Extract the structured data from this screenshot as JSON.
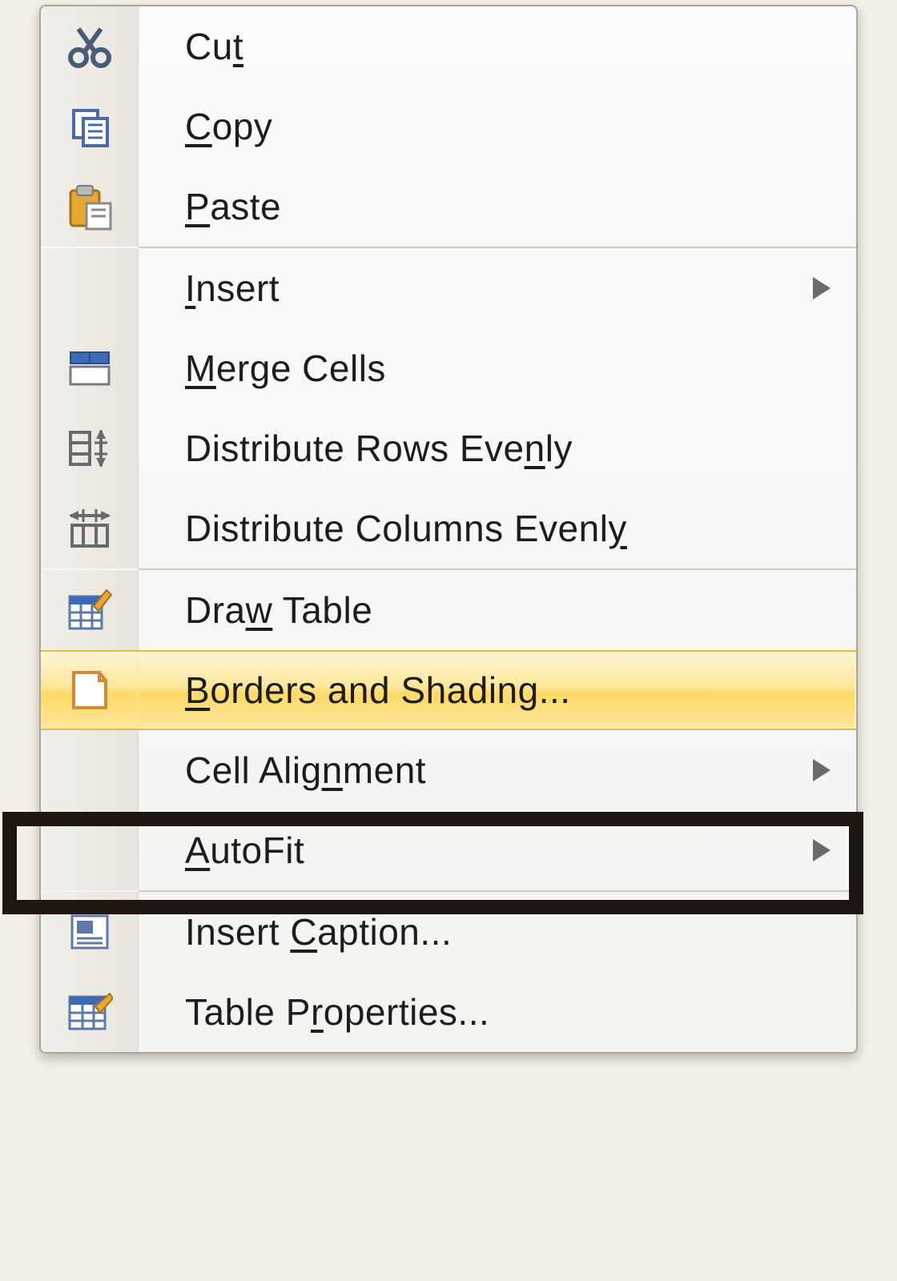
{
  "menu": {
    "items": [
      {
        "icon": "cut-icon",
        "label": "Cu<u>t</u>",
        "submenu": false
      },
      {
        "icon": "copy-icon",
        "label": "<u>C</u>opy",
        "submenu": false
      },
      {
        "icon": "paste-icon",
        "label": "<u>P</u>aste",
        "submenu": false
      },
      {
        "sep": true
      },
      {
        "icon": "",
        "label": "<u>I</u>nsert",
        "submenu": true
      },
      {
        "icon": "merge-cells-icon",
        "label": "<u>M</u>erge Cells",
        "submenu": false
      },
      {
        "icon": "distribute-rows-icon",
        "label": "Distribute Rows Eve<u>n</u>ly",
        "submenu": false
      },
      {
        "icon": "distribute-cols-icon",
        "label": "Distribute Columns Evenl<u>y</u>",
        "submenu": false
      },
      {
        "sep": true
      },
      {
        "icon": "draw-table-icon",
        "label": "Dra<u>w</u> Table",
        "submenu": false
      },
      {
        "icon": "borders-shading-icon",
        "label": "<u>B</u>orders and Shading...",
        "submenu": false,
        "highlight": true
      },
      {
        "icon": "",
        "label": "Cell Alig<u>n</u>ment",
        "submenu": true
      },
      {
        "icon": "",
        "label": "<u>A</u>utoFit",
        "submenu": true
      },
      {
        "sep": true
      },
      {
        "icon": "insert-caption-icon",
        "label": "Insert <u>C</u>aption...",
        "submenu": false
      },
      {
        "icon": "table-properties-icon",
        "label": "Table P<u>r</u>operties...",
        "submenu": false
      }
    ]
  },
  "callout": {
    "target_label": "Borders and Shading..."
  }
}
